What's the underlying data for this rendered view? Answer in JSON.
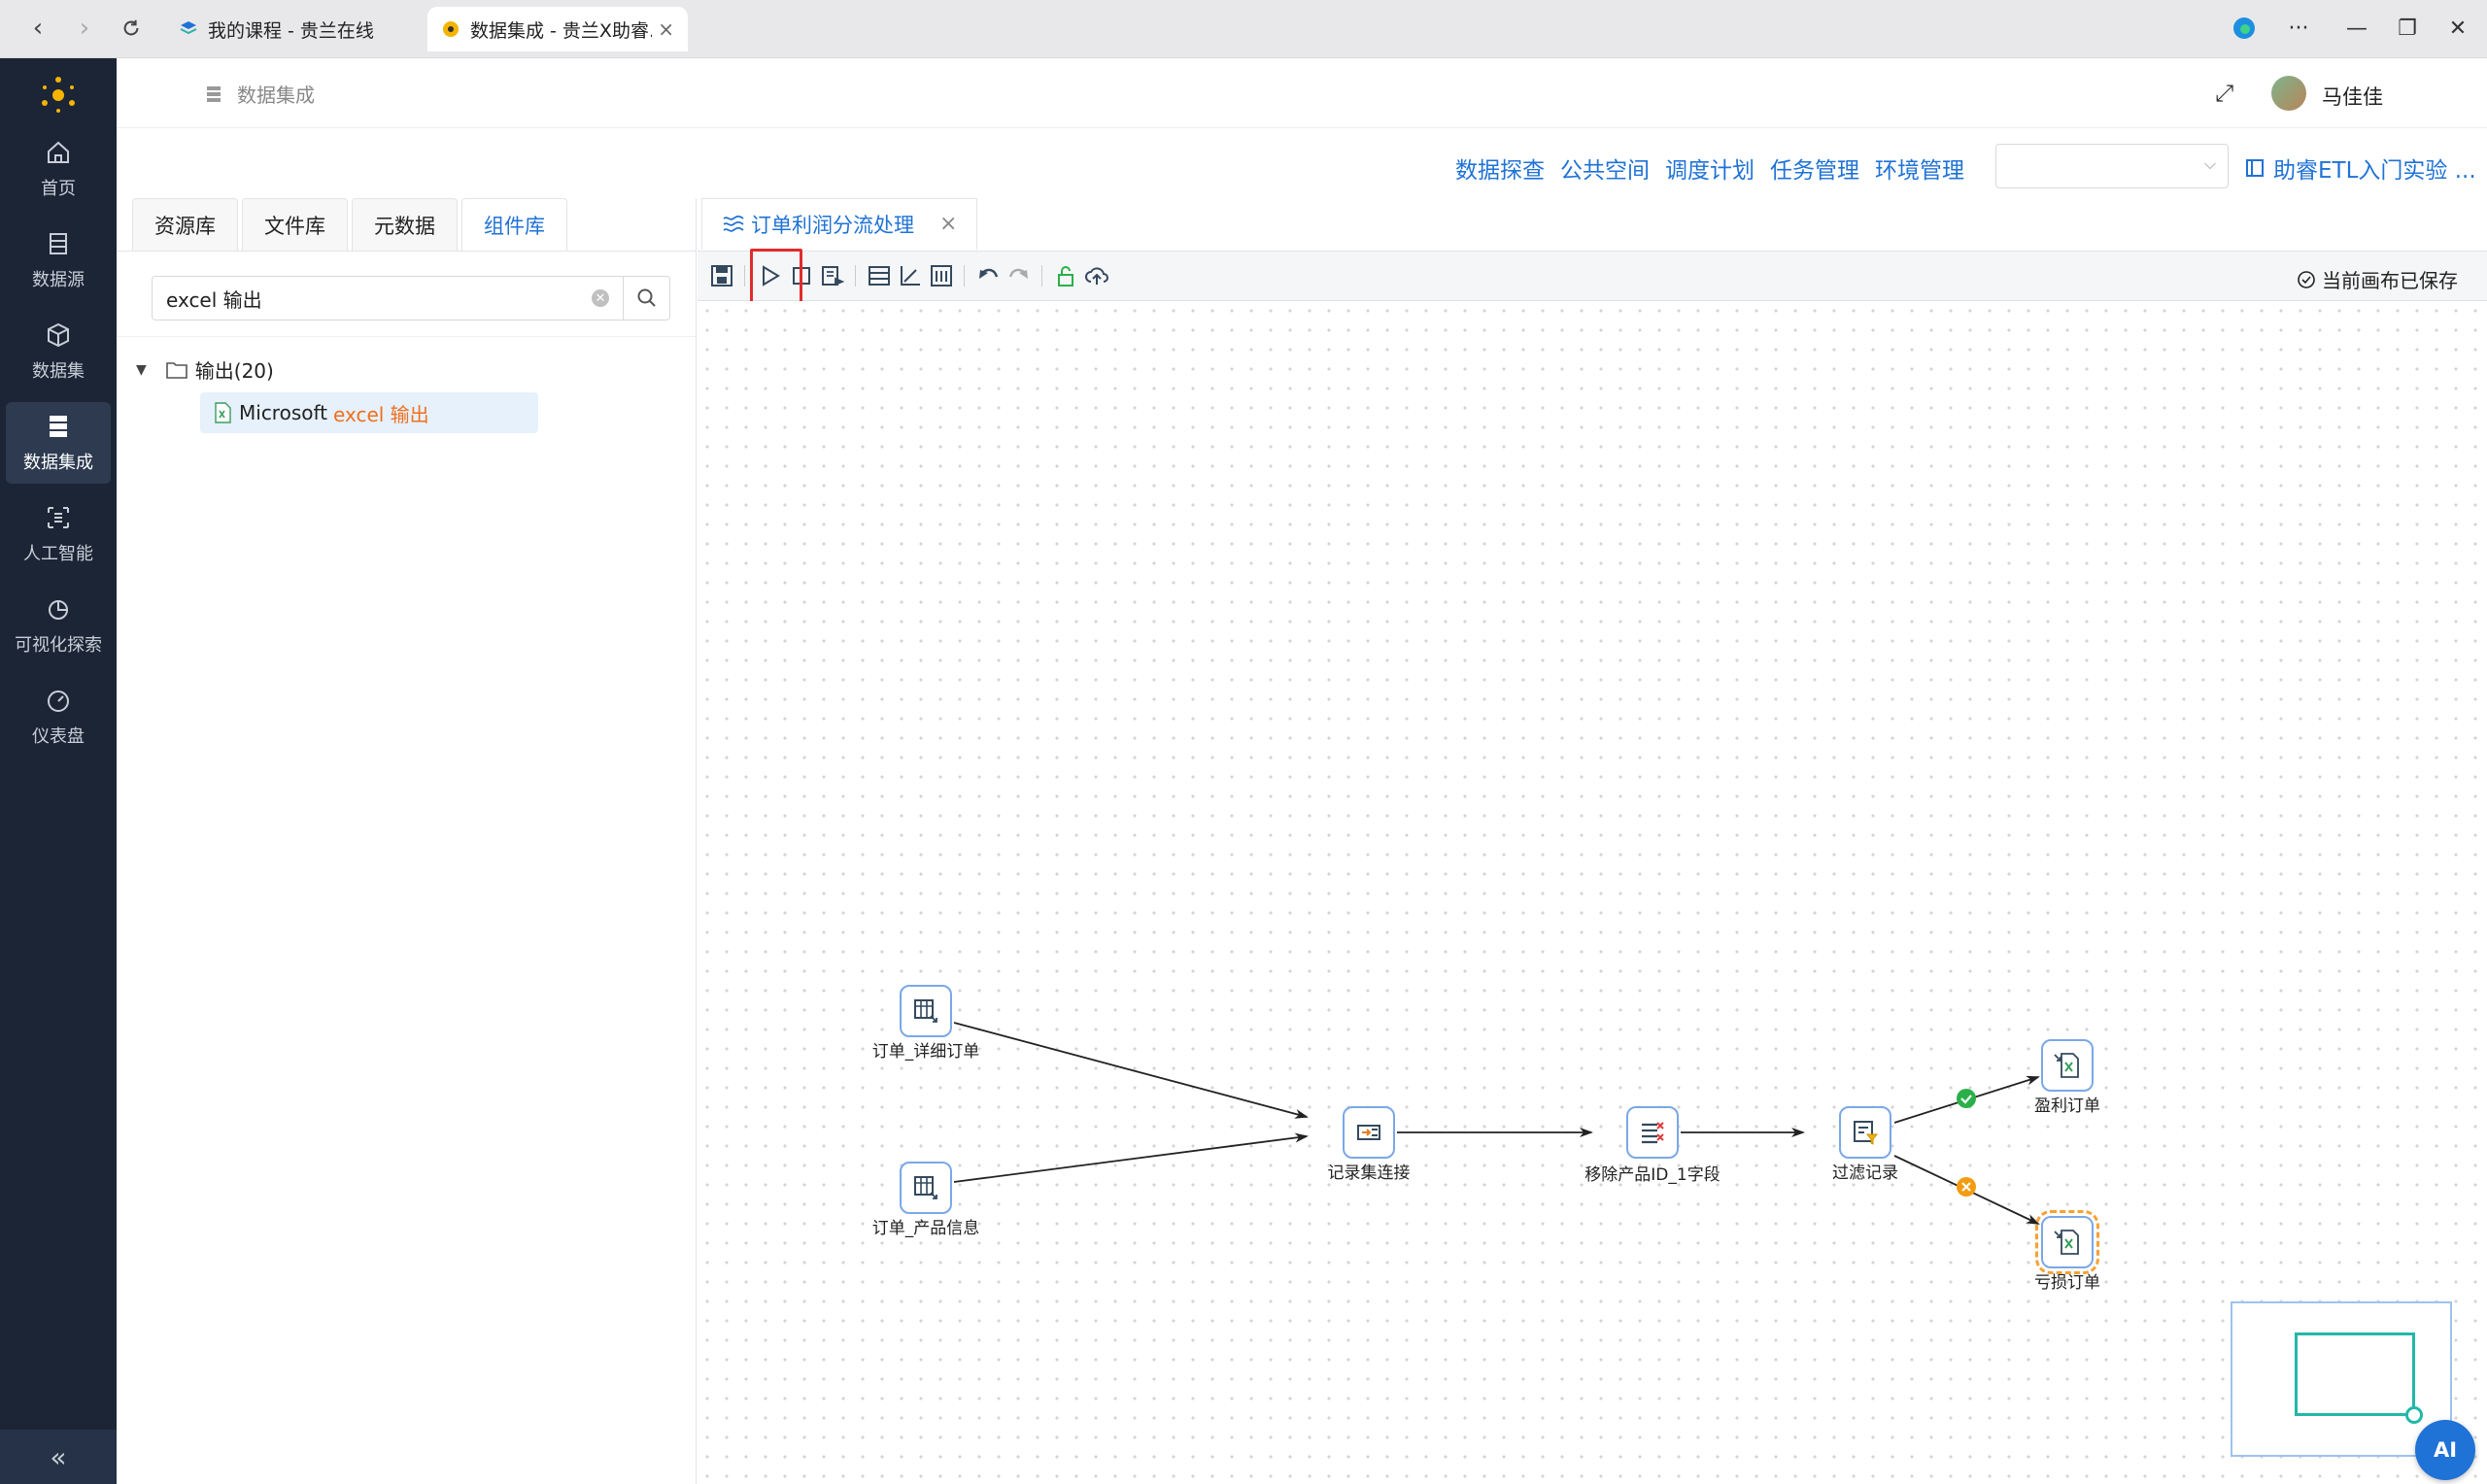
{
  "browser": {
    "tabs": [
      {
        "title": "我的课程 - 贵兰在线"
      },
      {
        "title": "数据集成 - 贵兰X助睿..."
      }
    ]
  },
  "nav": {
    "items": [
      {
        "label": "首页",
        "icon": "home-icon"
      },
      {
        "label": "数据源",
        "icon": "database-icon"
      },
      {
        "label": "数据集",
        "icon": "cube-icon"
      },
      {
        "label": "数据集成",
        "icon": "server-icon",
        "active": true
      },
      {
        "label": "人工智能",
        "icon": "ai-icon"
      },
      {
        "label": "可视化探索",
        "icon": "pie-chart-icon"
      },
      {
        "label": "仪表盘",
        "icon": "gauge-icon"
      }
    ],
    "collapse": "«"
  },
  "header": {
    "breadcrumb": "数据集成",
    "user": "马佳佳"
  },
  "toplinks": [
    "数据探查",
    "公共空间",
    "调度计划",
    "任务管理",
    "环境管理"
  ],
  "env_select": {
    "value": ""
  },
  "guide_link": "助睿ETL入门实验 ...",
  "left_panel": {
    "tabs": [
      "资源库",
      "文件库",
      "元数据",
      "组件库"
    ],
    "active_tab": "组件库",
    "search": {
      "value": "excel 输出"
    },
    "tree": {
      "folder": "输出(20)",
      "leaf_prefix": "Microsoft",
      "leaf_highlight": "excel 输出"
    }
  },
  "canvas_tab": {
    "title": "订单利润分流处理"
  },
  "toolbar": {
    "saved_status": "当前画布已保存"
  },
  "flow": {
    "nodes": [
      {
        "label": "订单_详细订单",
        "icon": "table-input-icon"
      },
      {
        "label": "订单_产品信息",
        "icon": "table-input-icon"
      },
      {
        "label": "记录集连接",
        "icon": "join-icon"
      },
      {
        "label": "移除产品ID_1字段",
        "icon": "remove-field-icon"
      },
      {
        "label": "过滤记录",
        "icon": "filter-icon"
      },
      {
        "label": "盈利订单",
        "icon": "excel-output-icon"
      },
      {
        "label": "亏损订单",
        "icon": "excel-output-icon"
      }
    ],
    "colors": {
      "true_branch": "#2ab04a",
      "false_branch": "#f39c12",
      "node_border": "#7aa8e6"
    }
  },
  "ai_button": "AI"
}
